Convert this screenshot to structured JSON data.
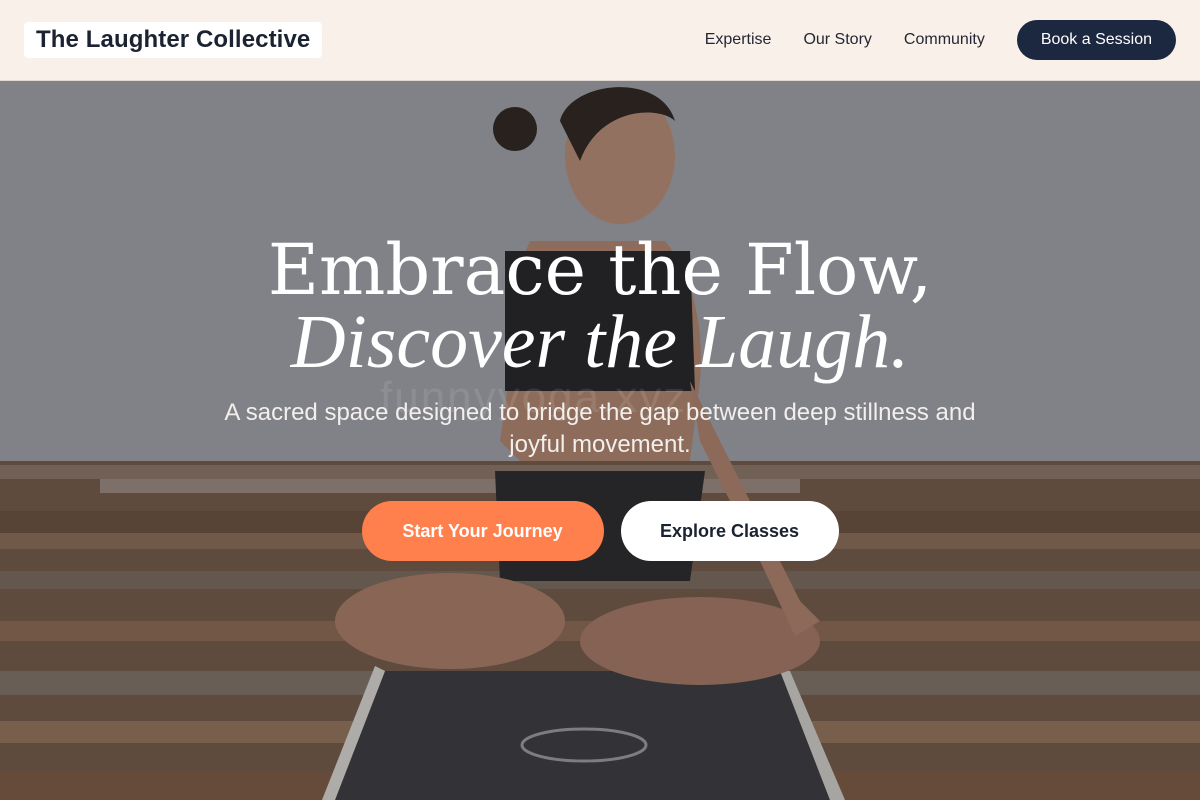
{
  "header": {
    "brand": "The Laughter Collective",
    "nav": [
      "Expertise",
      "Our Story",
      "Community"
    ],
    "cta": "Book a Session"
  },
  "hero": {
    "headline_line1": "Embrace the Flow,",
    "headline_line2": "Discover the Laugh.",
    "subtitle": "A sacred space designed to bridge the gap between deep stillness and joyful movement.",
    "watermark": "funnyyoga.xyz",
    "primary_cta": "Start Your Journey",
    "secondary_cta": "Explore Classes",
    "image": "woman-seated-yoga-pose-photo"
  },
  "colors": {
    "header_bg": "#faf0ea",
    "navy": "#1c2740",
    "coral": "#ff7f4d",
    "white": "#ffffff"
  }
}
